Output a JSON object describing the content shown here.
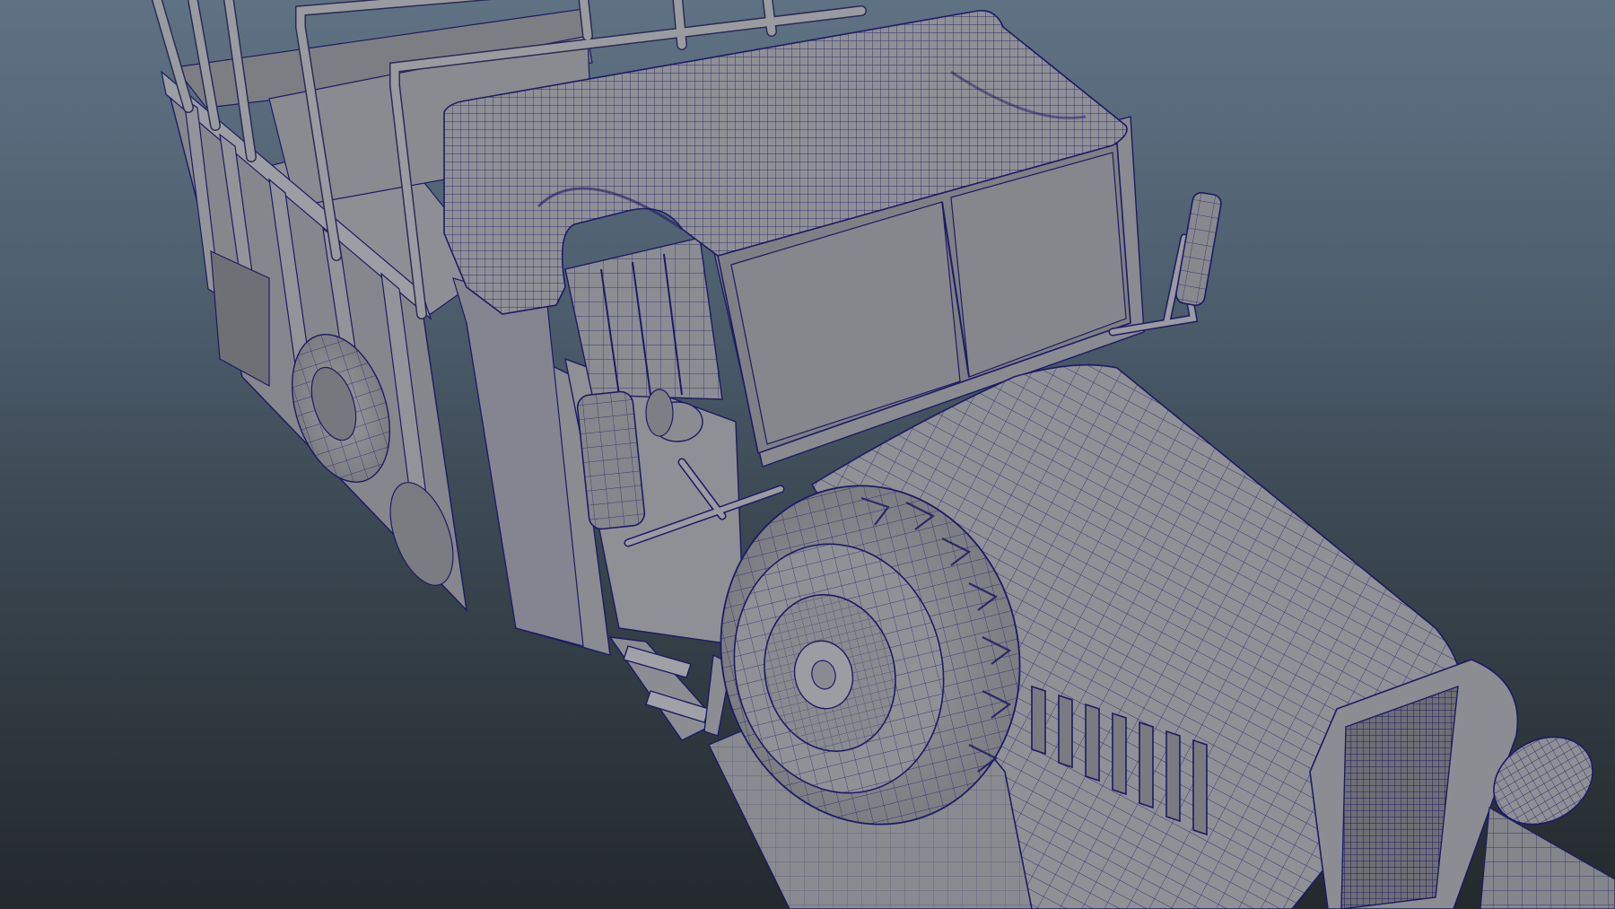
{
  "viewport": {
    "background_top": "#5f7284",
    "background_bottom": "#23292d",
    "model_shade": "#8d8e93",
    "wire_color": "#1c1a66"
  },
  "model": {
    "parts": [
      "cargo-bed",
      "canvas-roof",
      "cab",
      "windshield",
      "hood",
      "grille",
      "headlight",
      "spare-wheel",
      "rear-wheel",
      "side-mirror-left",
      "side-mirror-right",
      "step-ladder",
      "fender",
      "roll-bars"
    ]
  }
}
